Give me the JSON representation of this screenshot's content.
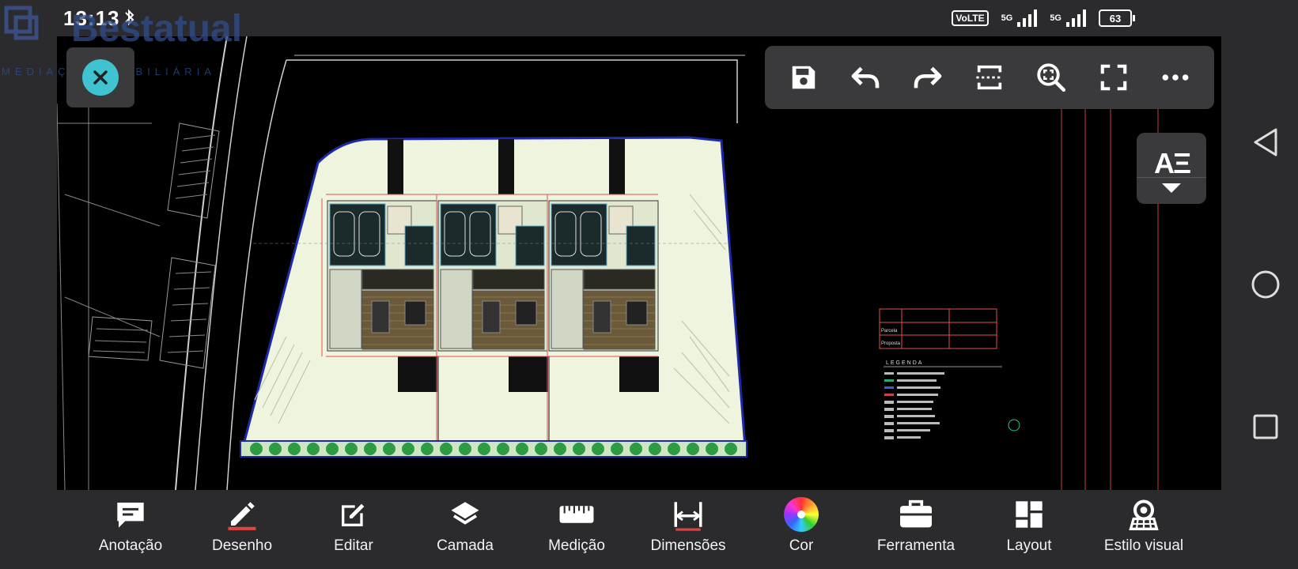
{
  "status_bar": {
    "time": "13:13",
    "volte": "VoLTE",
    "network_1": "5G",
    "network_2": "5G",
    "battery": "63"
  },
  "watermark": {
    "brand": "Bestatual",
    "tagline": "MEDIAÇÃO IMOBILIÁRIA"
  },
  "top_toolbar": {
    "icons": [
      "save-icon",
      "undo-icon",
      "redo-icon",
      "crop-icon",
      "zoom-extents-icon",
      "fullscreen-icon",
      "more-icon"
    ]
  },
  "text_style_button": {
    "label": "AΞ"
  },
  "bottom_toolbar": {
    "items": [
      {
        "label": "Anotação",
        "icon": "annotation-icon"
      },
      {
        "label": "Desenho",
        "icon": "pencil-icon"
      },
      {
        "label": "Editar",
        "icon": "edit-icon"
      },
      {
        "label": "Camada",
        "icon": "layers-icon"
      },
      {
        "label": "Medição",
        "icon": "ruler-icon"
      },
      {
        "label": "Dimensões",
        "icon": "dimension-icon"
      },
      {
        "label": "Cor",
        "icon": "color-wheel-icon"
      },
      {
        "label": "Ferramenta",
        "icon": "toolbox-icon"
      },
      {
        "label": "Layout",
        "icon": "layout-icon"
      },
      {
        "label": "Estilo visual",
        "icon": "visual-style-icon"
      }
    ]
  },
  "drawing": {
    "legend_title": "LEGENDA",
    "table_rows": [
      "Parcela",
      "Proposta"
    ]
  },
  "colors": {
    "canvas_bg": "#000000",
    "ui_bg": "#2b2b2d",
    "panel_bg": "#3a3a3c",
    "close_accent": "#3fc3d0",
    "plot_boundary": "#1d2aa8",
    "site_fill": "#eef4de",
    "floor_wood": "#6b5a3a"
  }
}
